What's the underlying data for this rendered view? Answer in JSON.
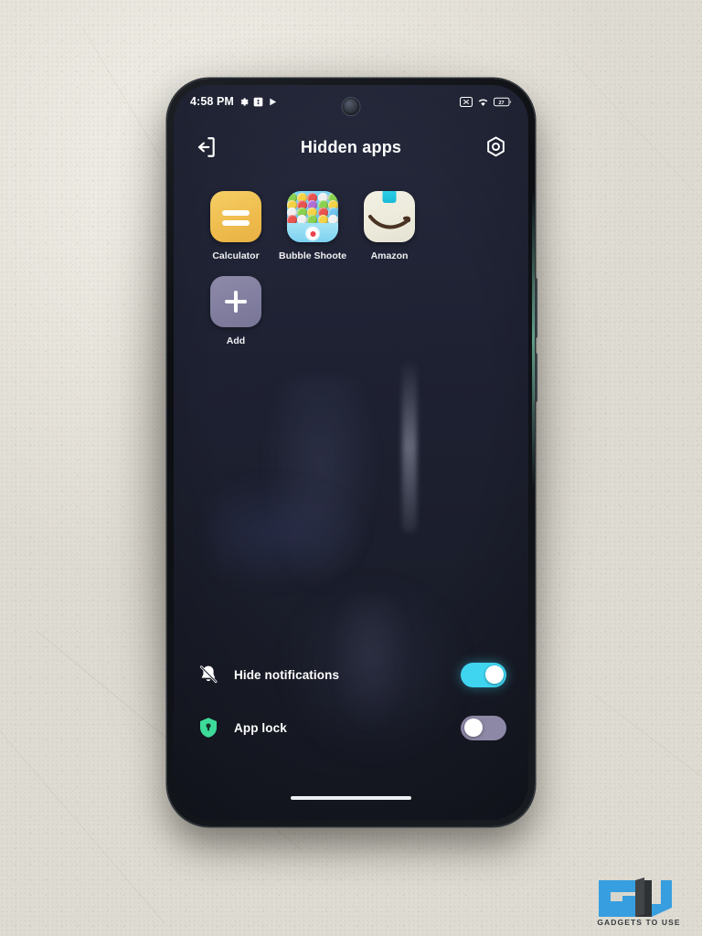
{
  "scene": {
    "description": "smartphone-photo-on-wall",
    "background_color": "#e9e7df"
  },
  "statusbar": {
    "time": "4:58 PM",
    "left_icons": [
      "gear-icon",
      "photo-app-icon",
      "play-icon"
    ],
    "right_icons": [
      "screenshot-icon",
      "wifi-icon",
      "battery-icon"
    ],
    "battery_level": "27"
  },
  "appbar": {
    "back_icon": "exit-arrow-icon",
    "title": "Hidden apps",
    "settings_icon": "gear-icon"
  },
  "apps": [
    {
      "label": "Calculator",
      "icon": "calculator-icon",
      "color": "#efbd4e"
    },
    {
      "label": "Bubble Shooter…",
      "icon": "bubble-shooter-icon",
      "color": "#6ec9ee"
    },
    {
      "label": "Amazon",
      "icon": "amazon-icon",
      "color": "#eceadb"
    },
    {
      "label": "Add",
      "icon": "plus-icon",
      "color": "#817ea0"
    }
  ],
  "settings_rows": [
    {
      "label": "Hide notifications",
      "icon": "bell-off-icon",
      "toggle": "on",
      "toggle_color": "#3fd5f0"
    },
    {
      "label": "App lock",
      "icon": "shield-lock-icon",
      "toggle": "off",
      "toggle_color": "#8d88a6"
    }
  ],
  "watermark": {
    "text": "GADGETS TO USE",
    "mark": "gu-logo",
    "color": "#2f9be0"
  }
}
